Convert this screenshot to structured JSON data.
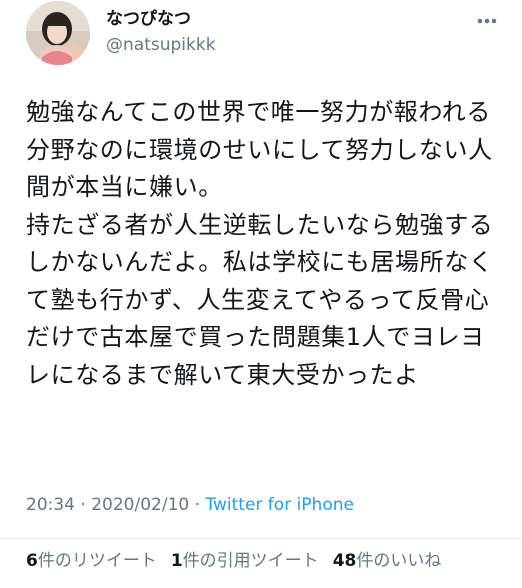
{
  "user": {
    "display_name": "なつぴなつ",
    "handle": "@natsupikkk"
  },
  "tweet": {
    "text": "勉強なんてこの世界で唯一努力が報われる分野なのに環境のせいにして努力しない人間が本当に嫌い。\n持たざる者が人生逆転したいなら勉強するしかないんだよ。私は学校にも居場所なくて塾も行かず、人生変えてやるって反骨心だけで古本屋で買った問題集1人でヨレヨレになるまで解いて東大受かったよ",
    "time": "20:34",
    "separator": " · ",
    "date": "2020/02/10",
    "source": "Twitter for iPhone"
  },
  "stats": {
    "retweets": {
      "count": "6",
      "label": "件のリツイート"
    },
    "quotes": {
      "count": "1",
      "label": "件の引用ツイート"
    },
    "likes": {
      "count": "48",
      "label": "件のいいね"
    }
  },
  "icons": {
    "more": "more-horizontal-icon",
    "avatar": "user-avatar"
  },
  "colors": {
    "text": "#14171a",
    "secondary": "#657786",
    "link": "#1da1f2",
    "divider": "#e6ecf0"
  }
}
